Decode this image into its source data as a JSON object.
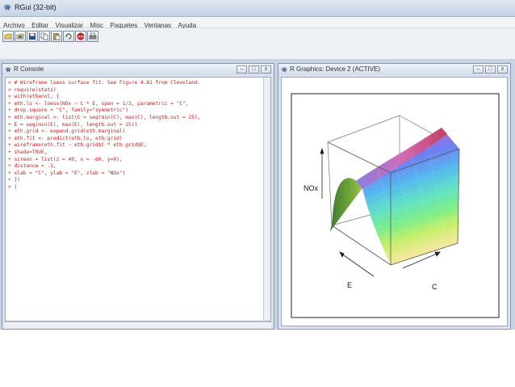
{
  "app": {
    "title": "RGui (32-bit)"
  },
  "menubar": {
    "items": [
      "Archivo",
      "Editar",
      "Visualizar",
      "Misc",
      "Paquetes",
      "Ventanas",
      "Ayuda"
    ]
  },
  "toolbar": {
    "buttons": [
      "open-script-icon",
      "load-workspace-icon",
      "save-icon",
      "copy-icon",
      "paste-icon",
      "copy-paste-icon",
      "stop-icon",
      "print-icon"
    ]
  },
  "console": {
    "title": "R Console",
    "lines": [
      "> # Wireframe loess surface fit. See Figure 4.61 from Cleveland.",
      "> require(stats)",
      "> with(ethanol, {",
      "+ eth.lo <- loess(NOx ~ C * E, span = 1/3, parametric = \"C\",",
      "+ drop.square = \"C\", family=\"symmetric\")",
      "+ eth.marginal <- list(C = seq(min(C), max(C), length.out = 25),",
      "+ E = seq(min(E), max(E), length.out = 25))",
      "+ eth.grid <- expand.grid(eth.marginal)",
      "+ eth.fit <- predict(eth.lo, eth.grid)",
      "+ wireframe(eth.fit ~ eth.grid$C * eth.grid$E,",
      "+ shade=TRUE,",
      "+ screen = list(z = 40, x = -60, y=0),",
      "+ distance = .1,",
      "+ xlab = \"C\", ylab = \"E\", zlab = \"NOx\")",
      "+ })",
      "> "
    ]
  },
  "graphics": {
    "title": "R Graphics: Device 2 (ACTIVE)",
    "zlab": "NOx",
    "ylab": "E",
    "xlab": "C"
  },
  "window_controls": {
    "minimize": "–",
    "maximize": "□",
    "close": "x"
  }
}
